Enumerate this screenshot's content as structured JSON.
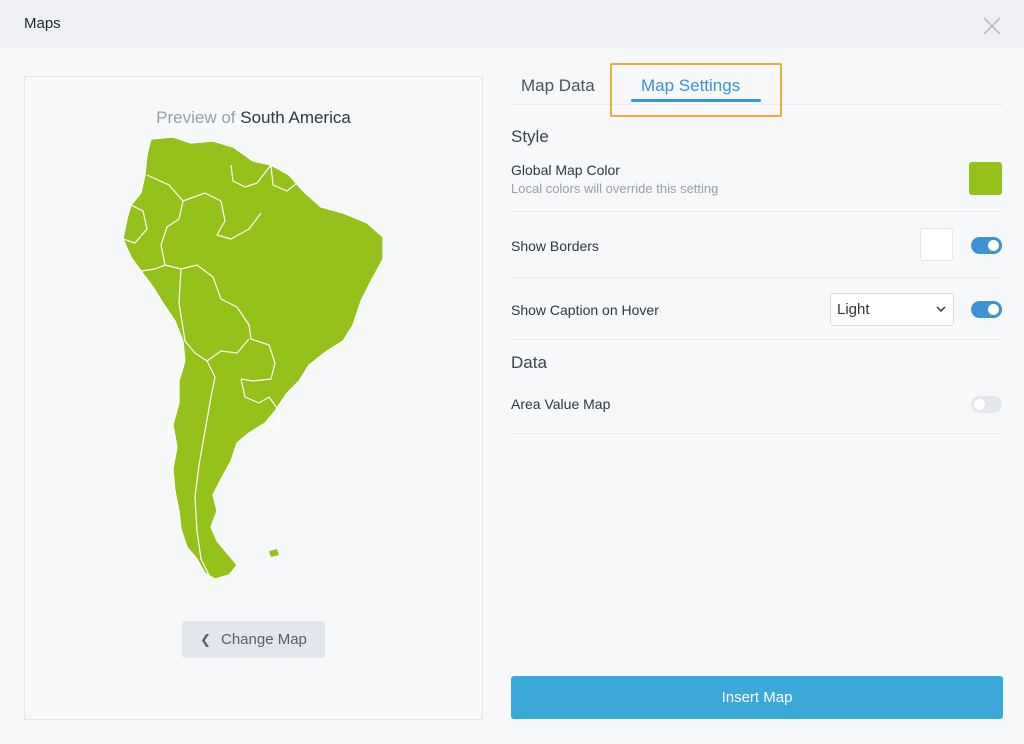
{
  "window": {
    "title": "Maps"
  },
  "preview": {
    "prefix": "Preview of",
    "region": "South America",
    "map_color": "#94c11a",
    "change_map_label": "Change Map"
  },
  "tabs": [
    {
      "label": "Map Data",
      "active": false
    },
    {
      "label": "Map Settings",
      "active": true
    }
  ],
  "style_section": {
    "heading": "Style",
    "global_color": {
      "label": "Global Map Color",
      "hint": "Local colors will override this setting",
      "color": "#94c11a"
    },
    "show_borders": {
      "label": "Show Borders",
      "border_color": "#ffffff",
      "enabled": true
    },
    "show_caption": {
      "label": "Show Caption on Hover",
      "selected_option": "Light",
      "enabled": true
    }
  },
  "data_section": {
    "heading": "Data",
    "area_value_map": {
      "label": "Area Value Map",
      "enabled": false
    }
  },
  "insert_label": "Insert Map",
  "colors": {
    "accent": "#3a94d6",
    "insert_button": "#3aa8d8",
    "highlight": "#f2a93b"
  }
}
